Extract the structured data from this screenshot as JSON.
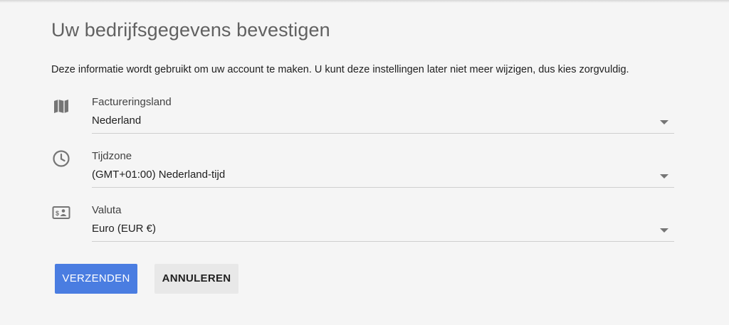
{
  "page": {
    "title": "Uw bedrijfsgegevens bevestigen",
    "description": "Deze informatie wordt gebruikt om uw account te maken. U kunt deze instellingen later niet meer wijzigen, dus kies zorgvuldig."
  },
  "fields": {
    "country": {
      "icon": "map-icon",
      "label": "Factureringsland",
      "value": "Nederland"
    },
    "timezone": {
      "icon": "clock-icon",
      "label": "Tijdzone",
      "value": "(GMT+01:00) Nederland-tijd"
    },
    "currency": {
      "icon": "currency-icon",
      "label": "Valuta",
      "value": "Euro (EUR €)"
    }
  },
  "actions": {
    "submit_label": "VERZENDEN",
    "cancel_label": "ANNULEREN"
  },
  "colors": {
    "background": "#f5f5f5",
    "primary": "#4a7de1",
    "secondary_button": "#e8e8e8",
    "icon": "#757575"
  }
}
